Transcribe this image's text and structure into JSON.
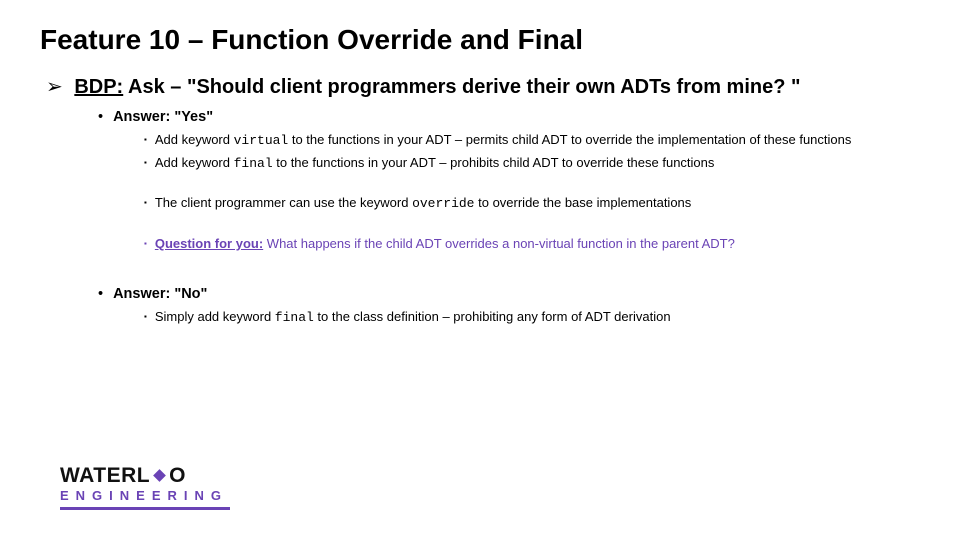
{
  "title": "Feature 10 – Function Override and Final",
  "bdp": {
    "label": "BDP:",
    "text": " Ask – \"Should client programmers derive their own ADTs from mine? \""
  },
  "yes": {
    "label": "Answer: \"Yes\"",
    "b1a": "Add keyword ",
    "b1code": "virtual",
    "b1b": " to the functions in your ADT – permits child ADT to override the implementation of these functions",
    "b2a": "Add keyword ",
    "b2code": "final",
    "b2b": " to the functions in your ADT – prohibits child ADT to override these functions",
    "b3a": "The client programmer can use the keyword ",
    "b3code": "override",
    "b3b": " to override the base implementations",
    "q_label": "Question for you:",
    "q_text": " What happens if the child ADT overrides a non-virtual function in the parent ADT?"
  },
  "no": {
    "label": "Answer: \"No\"",
    "b1a": "Simply add keyword ",
    "b1code": "final",
    "b1b": " to the class definition – prohibiting any form of ADT derivation"
  },
  "logo": {
    "top1": "WATERL",
    "top2": "O",
    "bottom": "ENGINEERING"
  }
}
